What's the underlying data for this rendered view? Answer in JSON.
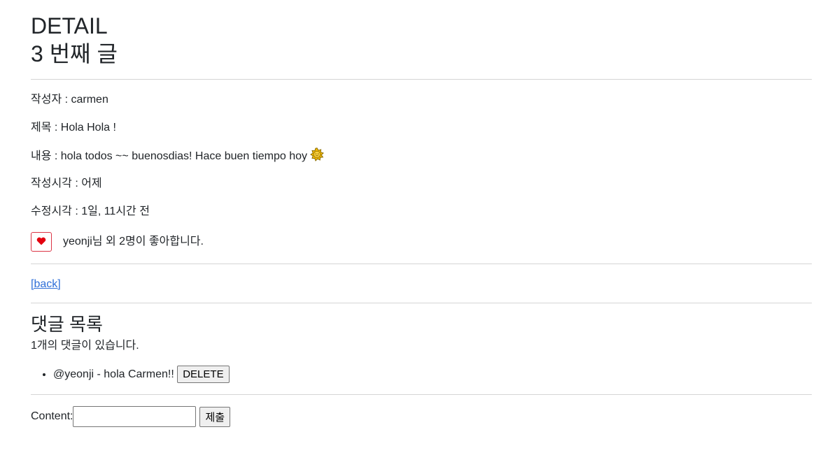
{
  "page": {
    "heading": "DETAIL",
    "post_heading": "3 번째 글"
  },
  "post": {
    "author": "작성자 : carmen",
    "title": "제목 : Hola Hola !",
    "content": "내용 : hola todos ~~ buenosdias! Hace buen tiempo hoy",
    "content_emoji": "sun-icon",
    "created": "작성시각 : 어제",
    "modified": "수정시각 : 1일, 11시간 전",
    "likes_text": "yeonji님 외 2명이 좋아합니다.",
    "like_icon": "heart-icon",
    "like_color": "#dc3545"
  },
  "nav": {
    "back_label": "[back]"
  },
  "comments": {
    "title": "댓글 목록",
    "count_text": "1개의 댓글이 있습니다.",
    "items": [
      {
        "text": "@yeonji - hola Carmen!!",
        "delete_label": "DELETE"
      }
    ]
  },
  "form": {
    "label": "Content:",
    "value": "",
    "submit_label": "제출"
  }
}
